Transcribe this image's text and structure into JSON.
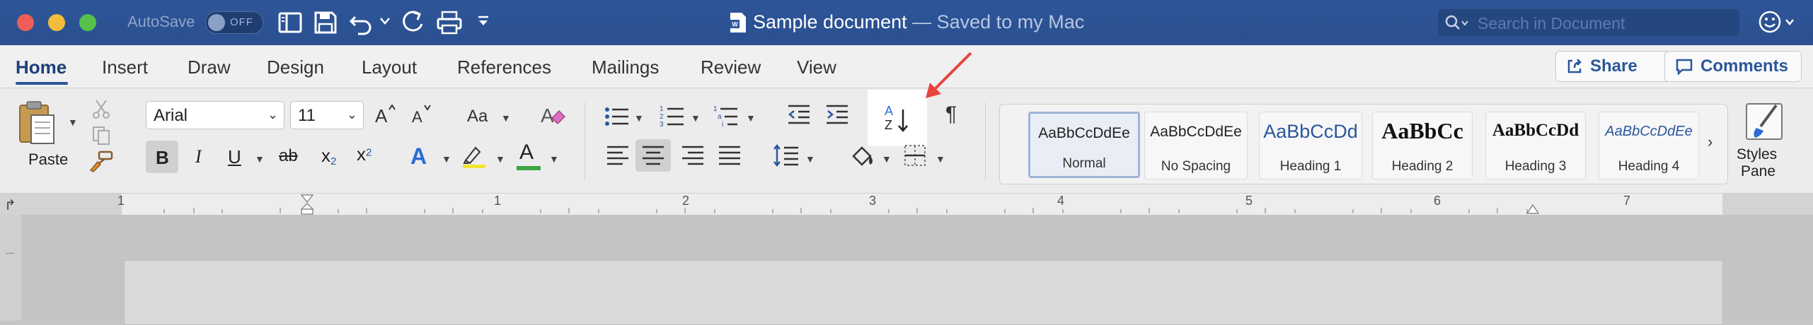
{
  "titlebar": {
    "autosave_label": "AutoSave",
    "autosave_state": "OFF",
    "doc_name": "Sample document",
    "doc_status": " — Saved to my Mac",
    "search_placeholder": "Search in Document"
  },
  "tabs": [
    "Home",
    "Insert",
    "Draw",
    "Design",
    "Layout",
    "References",
    "Mailings",
    "Review",
    "View"
  ],
  "active_tab": "Home",
  "share_label": "Share",
  "comments_label": "Comments",
  "ribbon": {
    "paste_label": "Paste",
    "font_name": "Arial",
    "font_size": "11",
    "bold": "B",
    "italic": "I",
    "underline": "U",
    "strike": "ab",
    "subscript": "x",
    "subscript_small": "2",
    "superscript": "x",
    "superscript_small": "2",
    "case_label": "Aa",
    "text_effects": "A",
    "font_color": "A",
    "sort_top": "A",
    "sort_bottom": "Z",
    "pilcrow": "¶",
    "styles_pane_line1": "Styles",
    "styles_pane_line2": "Pane"
  },
  "styles": [
    {
      "sample": "AaBbCcDdEe",
      "name": "Normal"
    },
    {
      "sample": "AaBbCcDdEe",
      "name": "No Spacing"
    },
    {
      "sample": "AaBbCcDd",
      "name": "Heading 1"
    },
    {
      "sample": "AaBbCc",
      "name": "Heading 2"
    },
    {
      "sample": "AaBbCcDd",
      "name": "Heading 3"
    },
    {
      "sample": "AaBbCcDdEe",
      "name": "Heading 4"
    }
  ],
  "ruler_numbers": [
    "1",
    "1",
    "2",
    "3",
    "4",
    "5",
    "6",
    "7"
  ],
  "colors": {
    "accent": "#2b579a",
    "highlight": "#f2e531",
    "font_color_bar": "#3aa644",
    "annotation_arrow": "#e8453c"
  }
}
